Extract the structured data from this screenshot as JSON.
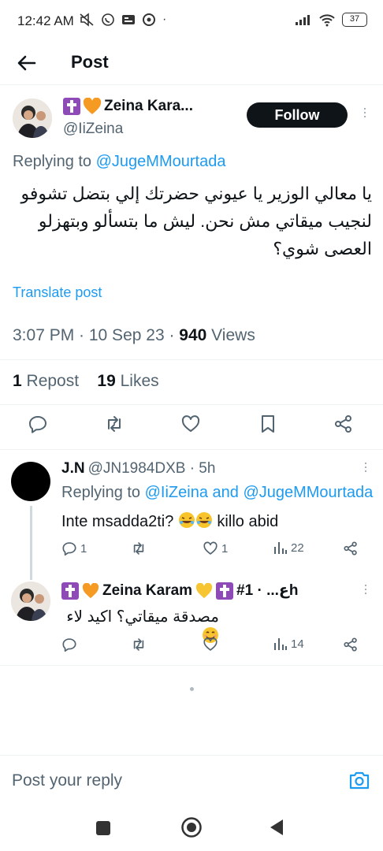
{
  "status_bar": {
    "time": "12:42 AM",
    "battery": "37"
  },
  "header": {
    "title": "Post"
  },
  "main_post": {
    "author_name": "Zeina Kara...",
    "author_handle": "@IiZeina",
    "follow_label": "Follow",
    "replying_prefix": "Replying to",
    "replying_to": "@JugeMMourtada",
    "text": "يا معالي الوزير يا عيوني حضرتك إلي بتضل تشوفو لنجيب ميقاتي مش نحن. ليش ما بتسألو وبتهزلو العصى شوي؟",
    "translate_label": "Translate post",
    "timestamp": "3:07 PM · 10 Sep 23 · ",
    "views_count": "940",
    "views_label": " Views",
    "reposts_count": "1",
    "reposts_label": " Repost",
    "likes_count": "19",
    "likes_label": " Likes"
  },
  "replies": [
    {
      "name": "J.N",
      "handle_time": "@JN1984DXB · 5h",
      "replying_prefix": "Replying to",
      "replying_to": "@IiZeina and @JugeMMourtada",
      "text_before": "Inte msadda2ti? ",
      "text_after": " killo abid",
      "reply_count": "1",
      "repost_count": "",
      "like_count": "1",
      "view_count": "22"
    },
    {
      "name": "Zeina Karam",
      "handle_time": "#ع... · 1h",
      "text": "مصدقة ميقاتي؟ اكيد لاء",
      "reply_count": "",
      "repost_count": "",
      "like_count": "",
      "view_count": "14"
    }
  ],
  "composer": {
    "placeholder": "Post your reply"
  },
  "colors": {
    "accent": "#1d9bf0",
    "secondary_text": "#536471",
    "follow_bg": "#0f1419",
    "cross_badge": "#8e4bb8",
    "heart_badge": "#f59a23",
    "yellow_heart": "#f7c531"
  },
  "icons": {
    "back": "arrow-left-icon",
    "reply": "comment-icon",
    "repost": "repost-icon",
    "like": "heart-icon",
    "bookmark": "bookmark-icon",
    "share": "share-icon",
    "views": "bar-chart-icon",
    "camera": "camera-icon"
  }
}
